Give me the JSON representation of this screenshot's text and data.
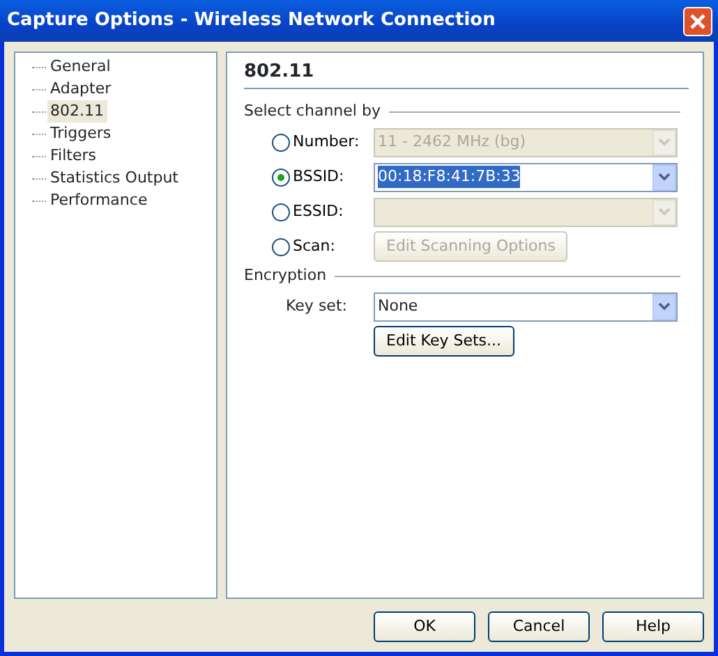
{
  "window": {
    "title": "Capture Options - Wireless Network Connection"
  },
  "sidebar": {
    "items": [
      {
        "label": "General",
        "selected": false
      },
      {
        "label": "Adapter",
        "selected": false
      },
      {
        "label": "802.11",
        "selected": true
      },
      {
        "label": "Triggers",
        "selected": false
      },
      {
        "label": "Filters",
        "selected": false
      },
      {
        "label": "Statistics Output",
        "selected": false
      },
      {
        "label": "Performance",
        "selected": false
      }
    ]
  },
  "page": {
    "title": "802.11",
    "channel_group": {
      "label": "Select channel by",
      "options": [
        {
          "label": "Number:",
          "selected": false,
          "kind": "dropdown",
          "value": "11 - 2462 MHz (bg)",
          "disabled": true,
          "highlighted": false
        },
        {
          "label": "BSSID:",
          "selected": true,
          "kind": "dropdown",
          "value": "00:18:F8:41:7B:33",
          "disabled": false,
          "highlighted": true
        },
        {
          "label": "ESSID:",
          "selected": false,
          "kind": "dropdown",
          "disabled": true,
          "highlighted": false
        },
        {
          "label": "Scan:",
          "selected": false,
          "kind": "button",
          "value": "Edit Scanning Options",
          "disabled": true
        }
      ]
    },
    "encryption_group": {
      "label": "Encryption",
      "key_set": {
        "label": "Key set:",
        "value": "None"
      },
      "edit_button": "Edit Key Sets..."
    }
  },
  "buttons": [
    "OK",
    "Cancel",
    "Help"
  ]
}
